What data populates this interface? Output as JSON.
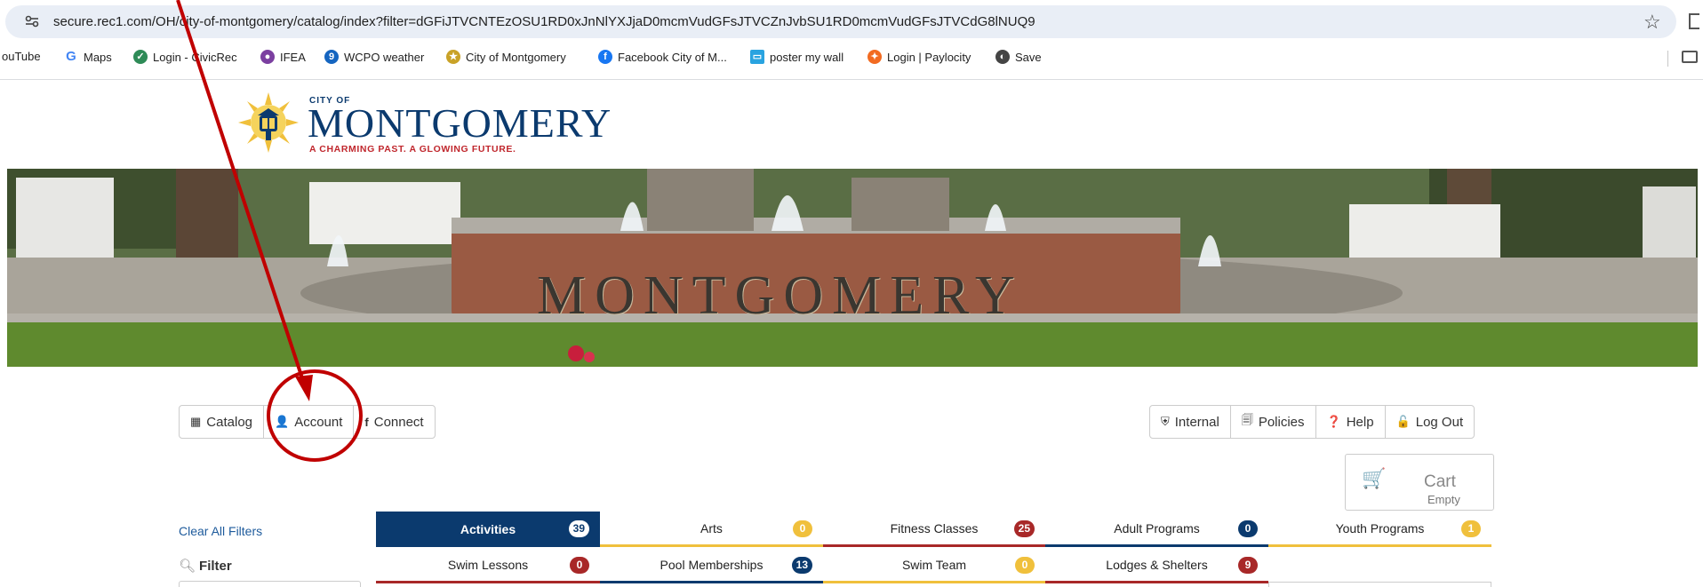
{
  "browser": {
    "url": "secure.rec1.com/OH/city-of-montgomery/catalog/index?filter=dGFiJTVCNTEzOSU1RD0xJnNlYXJjaD0mcmVudGFsJTVCZnJvbSU1RD0mcmVudGFsJTVCdG8lNUQ9",
    "bookmarks": [
      {
        "label": "ouTube",
        "icon": "youtube-icon",
        "color": "#ff0000"
      },
      {
        "label": "Maps",
        "icon": "google-icon",
        "color": "#4285f4"
      },
      {
        "label": "Login - CivicRec",
        "icon": "civicrec-icon",
        "color": "#2e8b57"
      },
      {
        "label": "IFEA",
        "icon": "ifea-icon",
        "color": "#7b3fa0"
      },
      {
        "label": "WCPO weather",
        "icon": "weather-icon",
        "color": "#1565c0"
      },
      {
        "label": "City of Montgomery",
        "icon": "city-seal-icon",
        "color": "#c9a227"
      },
      {
        "label": "Facebook City of M...",
        "icon": "facebook-icon",
        "color": "#1877f2"
      },
      {
        "label": "poster my wall",
        "icon": "postermywall-icon",
        "color": "#29a3e0"
      },
      {
        "label": "Login | Paylocity",
        "icon": "paylocity-icon",
        "color": "#f26b21"
      },
      {
        "label": "Save",
        "icon": "save-globe-icon",
        "color": "#444444"
      }
    ]
  },
  "logo": {
    "small": "CITY OF",
    "name": "MONTGOMERY",
    "tagline": "A CHARMING PAST. A GLOWING FUTURE."
  },
  "banner": {
    "engraved_text": "MONTGOMERY"
  },
  "nav_left": [
    {
      "label": "Catalog",
      "icon": "grid-icon"
    },
    {
      "label": "Account",
      "icon": "user-icon"
    },
    {
      "label": "Connect",
      "icon": "facebook-f-icon"
    }
  ],
  "nav_right": [
    {
      "label": "Internal",
      "icon": "shield-icon"
    },
    {
      "label": "Policies",
      "icon": "document-icon"
    },
    {
      "label": "Help",
      "icon": "question-circle-icon"
    },
    {
      "label": "Log Out",
      "icon": "unlock-icon"
    }
  ],
  "cart": {
    "label": "Cart",
    "status": "Empty"
  },
  "filters": {
    "clear_label": "Clear All Filters",
    "filter_label": "Filter"
  },
  "tabs_row1": [
    {
      "label": "Activities",
      "count": "39",
      "color": "#0b3a6e",
      "active": true
    },
    {
      "label": "Arts",
      "count": "0",
      "color": "#f0c03c",
      "active": false
    },
    {
      "label": "Fitness Classes",
      "count": "25",
      "color": "#a82828",
      "active": false
    },
    {
      "label": "Adult Programs",
      "count": "0",
      "color": "#0b3a6e",
      "active": false
    },
    {
      "label": "Youth Programs",
      "count": "1",
      "color": "#f0c03c",
      "active": false
    }
  ],
  "tabs_row2": [
    {
      "label": "Swim Lessons",
      "count": "0",
      "color": "#a82828",
      "active": false
    },
    {
      "label": "Pool Memberships",
      "count": "13",
      "color": "#0b3a6e",
      "active": false
    },
    {
      "label": "Swim Team",
      "count": "0",
      "color": "#f0c03c",
      "active": false
    },
    {
      "label": "Lodges & Shelters",
      "count": "9",
      "color": "#a82828",
      "active": false
    }
  ],
  "colors": {
    "brand_navy": "#0b3a6e",
    "brand_red": "#c0272d",
    "annotation_red": "#c00000",
    "link_blue": "#1e5b9c"
  }
}
